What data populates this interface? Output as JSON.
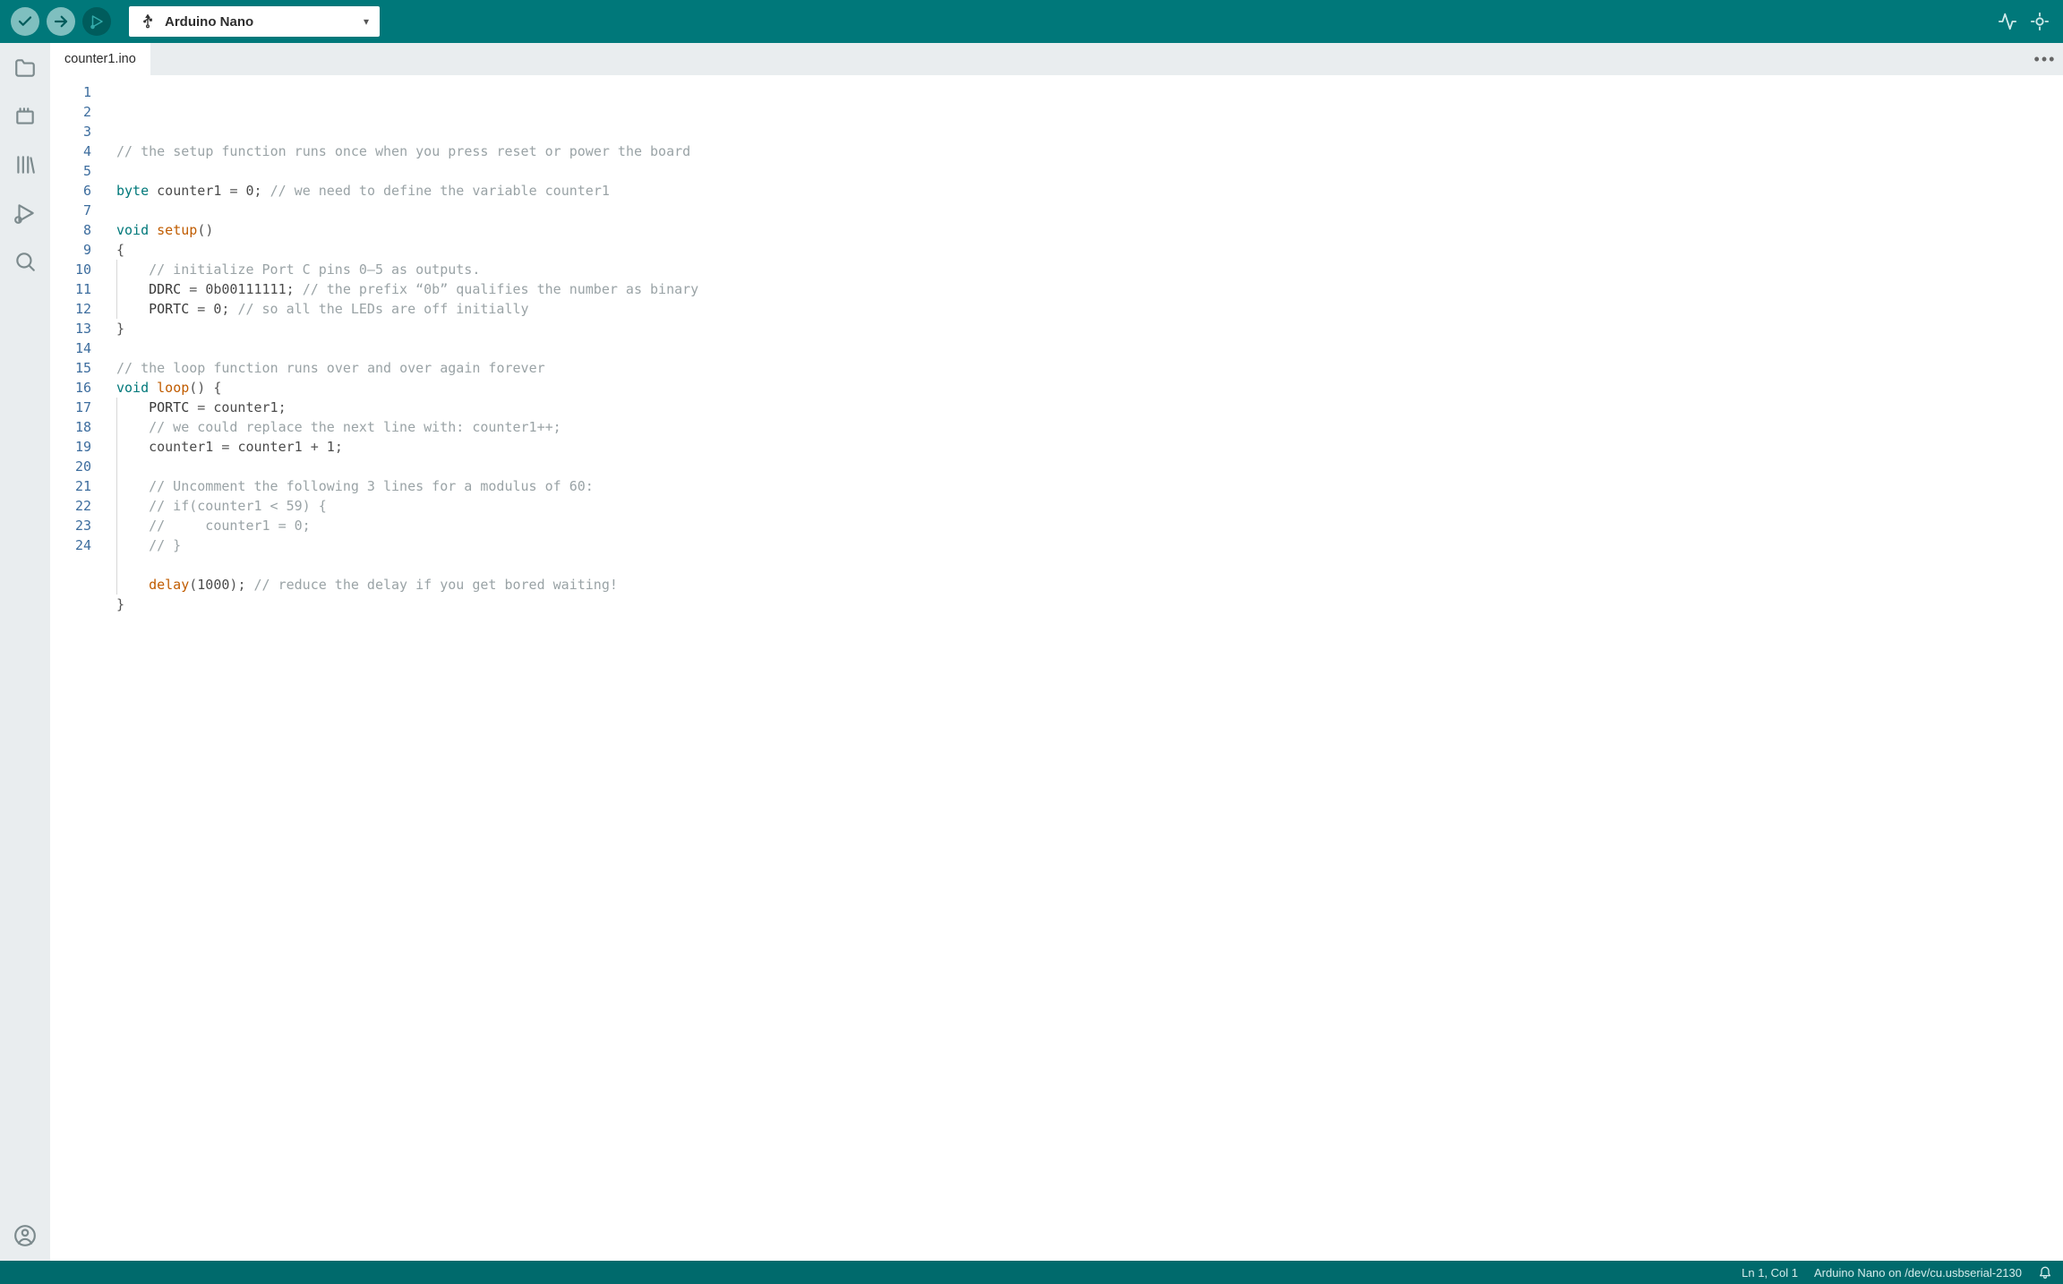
{
  "board_selector": {
    "label": "Arduino Nano"
  },
  "tabs": [
    {
      "label": "counter1.ino"
    }
  ],
  "statusbar": {
    "position": "Ln 1, Col 1",
    "board_info": "Arduino Nano on /dev/cu.usbserial-2130"
  },
  "code": {
    "lines": [
      {
        "n": 1,
        "indent": 0,
        "tokens": [
          {
            "c": "comment",
            "t": "// the setup function runs once when you press reset or power the board"
          }
        ]
      },
      {
        "n": 2,
        "indent": 0,
        "tokens": []
      },
      {
        "n": 3,
        "indent": 0,
        "tokens": [
          {
            "c": "type",
            "t": "byte"
          },
          {
            "c": "",
            "t": " "
          },
          {
            "c": "var",
            "t": "counter1"
          },
          {
            "c": "",
            "t": " "
          },
          {
            "c": "punct",
            "t": "="
          },
          {
            "c": "",
            "t": " "
          },
          {
            "c": "num",
            "t": "0"
          },
          {
            "c": "punct",
            "t": ";"
          },
          {
            "c": "",
            "t": " "
          },
          {
            "c": "comment",
            "t": "// we need to define the variable counter1"
          }
        ]
      },
      {
        "n": 4,
        "indent": 0,
        "tokens": []
      },
      {
        "n": 5,
        "indent": 0,
        "tokens": [
          {
            "c": "kw",
            "t": "void"
          },
          {
            "c": "",
            "t": " "
          },
          {
            "c": "fn",
            "t": "setup"
          },
          {
            "c": "punct",
            "t": "()"
          }
        ]
      },
      {
        "n": 6,
        "indent": 0,
        "tokens": [
          {
            "c": "punct",
            "t": "{"
          }
        ]
      },
      {
        "n": 7,
        "indent": 2,
        "tokens": [
          {
            "c": "comment",
            "t": "// initialize Port C pins 0–5 as outputs."
          }
        ]
      },
      {
        "n": 8,
        "indent": 2,
        "tokens": [
          {
            "c": "reg",
            "t": "DDRC"
          },
          {
            "c": "",
            "t": " "
          },
          {
            "c": "punct",
            "t": "="
          },
          {
            "c": "",
            "t": " "
          },
          {
            "c": "num",
            "t": "0b00111111"
          },
          {
            "c": "punct",
            "t": ";"
          },
          {
            "c": "",
            "t": " "
          },
          {
            "c": "comment",
            "t": "// the prefix “0b” qualifies the number as binary"
          }
        ]
      },
      {
        "n": 9,
        "indent": 2,
        "tokens": [
          {
            "c": "reg",
            "t": "PORTC"
          },
          {
            "c": "",
            "t": " "
          },
          {
            "c": "punct",
            "t": "="
          },
          {
            "c": "",
            "t": " "
          },
          {
            "c": "num",
            "t": "0"
          },
          {
            "c": "punct",
            "t": ";"
          },
          {
            "c": "",
            "t": " "
          },
          {
            "c": "comment",
            "t": "// so all the LEDs are off initially"
          }
        ]
      },
      {
        "n": 10,
        "indent": 0,
        "tokens": [
          {
            "c": "punct",
            "t": "}"
          }
        ]
      },
      {
        "n": 11,
        "indent": 0,
        "tokens": []
      },
      {
        "n": 12,
        "indent": 0,
        "tokens": [
          {
            "c": "comment",
            "t": "// the loop function runs over and over again forever"
          }
        ]
      },
      {
        "n": 13,
        "indent": 0,
        "tokens": [
          {
            "c": "kw",
            "t": "void"
          },
          {
            "c": "",
            "t": " "
          },
          {
            "c": "fn",
            "t": "loop"
          },
          {
            "c": "punct",
            "t": "()"
          },
          {
            "c": "",
            "t": " "
          },
          {
            "c": "punct",
            "t": "{"
          }
        ]
      },
      {
        "n": 14,
        "indent": 2,
        "tokens": [
          {
            "c": "reg",
            "t": "PORTC"
          },
          {
            "c": "",
            "t": " "
          },
          {
            "c": "punct",
            "t": "="
          },
          {
            "c": "",
            "t": " "
          },
          {
            "c": "var",
            "t": "counter1"
          },
          {
            "c": "punct",
            "t": ";"
          }
        ]
      },
      {
        "n": 15,
        "indent": 2,
        "tokens": [
          {
            "c": "comment",
            "t": "// we could replace the next line with: counter1++;"
          }
        ]
      },
      {
        "n": 16,
        "indent": 2,
        "tokens": [
          {
            "c": "var",
            "t": "counter1"
          },
          {
            "c": "",
            "t": " "
          },
          {
            "c": "punct",
            "t": "="
          },
          {
            "c": "",
            "t": " "
          },
          {
            "c": "var",
            "t": "counter1"
          },
          {
            "c": "",
            "t": " "
          },
          {
            "c": "punct",
            "t": "+"
          },
          {
            "c": "",
            "t": " "
          },
          {
            "c": "num",
            "t": "1"
          },
          {
            "c": "punct",
            "t": ";"
          }
        ]
      },
      {
        "n": 17,
        "indent": 2,
        "tokens": []
      },
      {
        "n": 18,
        "indent": 2,
        "tokens": [
          {
            "c": "comment",
            "t": "// Uncomment the following 3 lines for a modulus of 60:"
          }
        ]
      },
      {
        "n": 19,
        "indent": 2,
        "tokens": [
          {
            "c": "comment",
            "t": "// if(counter1 < 59) {"
          }
        ]
      },
      {
        "n": 20,
        "indent": 2,
        "tokens": [
          {
            "c": "comment",
            "t": "//     counter1 = 0;"
          }
        ]
      },
      {
        "n": 21,
        "indent": 2,
        "tokens": [
          {
            "c": "comment",
            "t": "// }"
          }
        ]
      },
      {
        "n": 22,
        "indent": 2,
        "tokens": []
      },
      {
        "n": 23,
        "indent": 2,
        "tokens": [
          {
            "c": "fn",
            "t": "delay"
          },
          {
            "c": "punct",
            "t": "("
          },
          {
            "c": "num",
            "t": "1000"
          },
          {
            "c": "punct",
            "t": ")"
          },
          {
            "c": "punct",
            "t": ";"
          },
          {
            "c": "",
            "t": " "
          },
          {
            "c": "comment",
            "t": "// reduce the delay if you get bored waiting!"
          }
        ]
      },
      {
        "n": 24,
        "indent": 0,
        "tokens": [
          {
            "c": "punct",
            "t": "}"
          }
        ]
      }
    ]
  }
}
